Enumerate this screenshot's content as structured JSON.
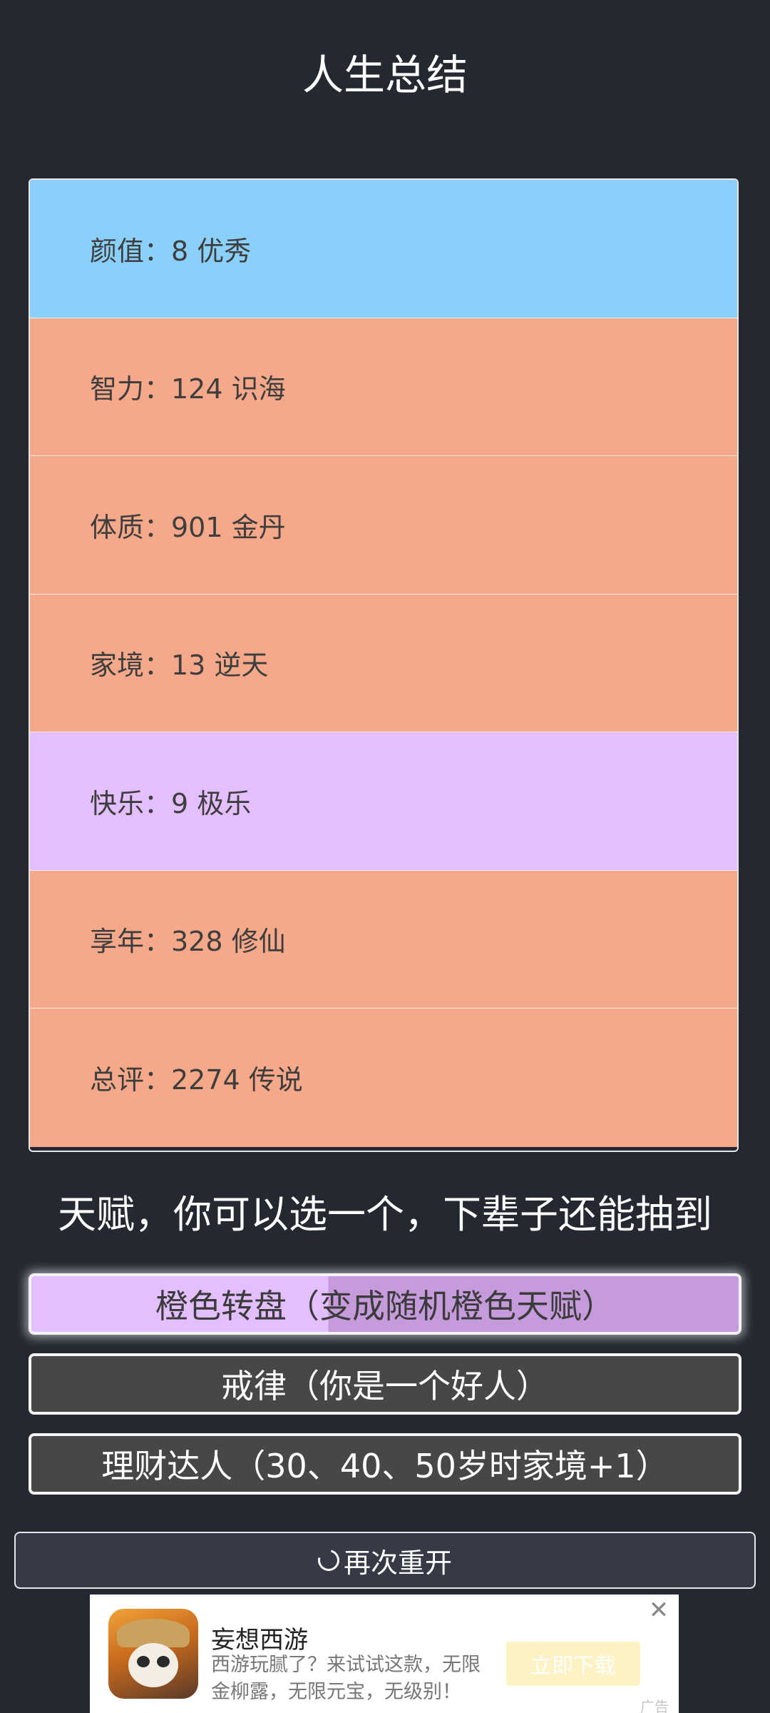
{
  "header": {
    "title": "人生总结"
  },
  "stats": [
    {
      "text": "颜值：8 优秀",
      "color": "#8ad0fa"
    },
    {
      "text": "智力：124 识海",
      "color": "#f6a98a"
    },
    {
      "text": "体质：901 金丹",
      "color": "#f6a98a"
    },
    {
      "text": "家境：13 逆天",
      "color": "#f6a98a"
    },
    {
      "text": "快乐：9 极乐",
      "color": "#e3bfff"
    },
    {
      "text": "享年：328 修仙",
      "color": "#f6a98a"
    },
    {
      "text": "总评：2274 传说",
      "color": "#f6a98a"
    }
  ],
  "talents": {
    "heading": "天赋，你可以选一个，下辈子还能抽到",
    "options": [
      {
        "label": "橙色转盘（变成随机橙色天赋）",
        "selected": true
      },
      {
        "label": "戒律（你是一个好人）",
        "selected": false
      },
      {
        "label": "理财达人（30、40、50岁时家境+1）",
        "selected": false
      }
    ]
  },
  "restart": {
    "label": "再次重开",
    "icon": "refresh-icon"
  },
  "ad": {
    "title": "妄想西游",
    "desc": "西游玩腻了？来试试这款，无限金柳露，无限元宝，无级别！",
    "cta": "立即下载",
    "close": "✕",
    "tag": "广告"
  }
}
